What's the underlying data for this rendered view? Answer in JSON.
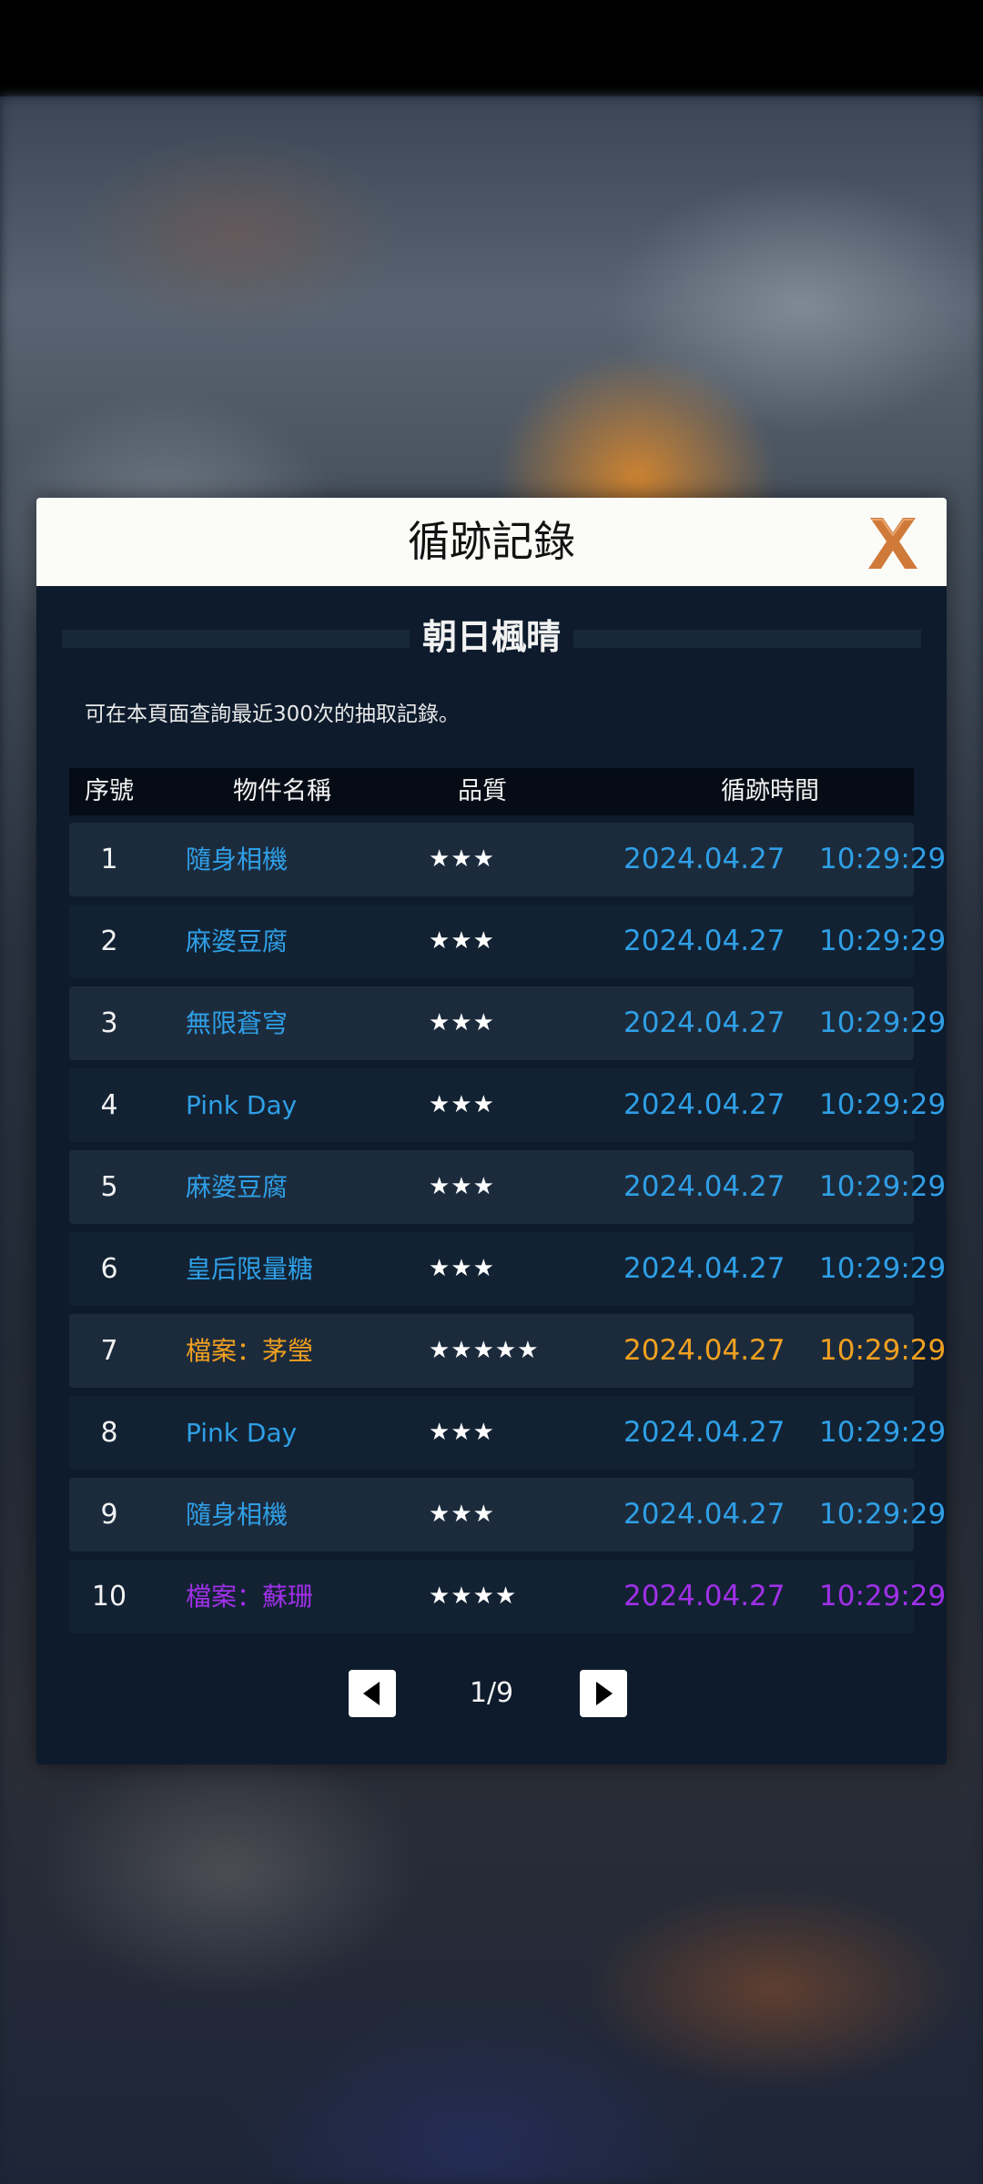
{
  "dialog": {
    "title": "循跡記錄",
    "section_title": "朝日楓晴",
    "description": "可在本頁面查詢最近300次的抽取記錄。"
  },
  "table": {
    "headers": [
      "序號",
      "物件名稱",
      "品質",
      "循跡時間"
    ],
    "rows": [
      {
        "index": "1",
        "name": "隨身相機",
        "stars": "★★★",
        "date": "2024.04.27",
        "time": "10:29:29",
        "rarity": "blue"
      },
      {
        "index": "2",
        "name": "麻婆豆腐",
        "stars": "★★★",
        "date": "2024.04.27",
        "time": "10:29:29",
        "rarity": "blue"
      },
      {
        "index": "3",
        "name": "無限蒼穹",
        "stars": "★★★",
        "date": "2024.04.27",
        "time": "10:29:29",
        "rarity": "blue"
      },
      {
        "index": "4",
        "name": "Pink Day",
        "stars": "★★★",
        "date": "2024.04.27",
        "time": "10:29:29",
        "rarity": "blue"
      },
      {
        "index": "5",
        "name": "麻婆豆腐",
        "stars": "★★★",
        "date": "2024.04.27",
        "time": "10:29:29",
        "rarity": "blue"
      },
      {
        "index": "6",
        "name": "皇后限量糖",
        "stars": "★★★",
        "date": "2024.04.27",
        "time": "10:29:29",
        "rarity": "blue"
      },
      {
        "index": "7",
        "name": "檔案：茅瑩",
        "stars": "★★★★★",
        "date": "2024.04.27",
        "time": "10:29:29",
        "rarity": "orange"
      },
      {
        "index": "8",
        "name": "Pink Day",
        "stars": "★★★",
        "date": "2024.04.27",
        "time": "10:29:29",
        "rarity": "blue"
      },
      {
        "index": "9",
        "name": "隨身相機",
        "stars": "★★★",
        "date": "2024.04.27",
        "time": "10:29:29",
        "rarity": "blue"
      },
      {
        "index": "10",
        "name": "檔案：蘇珊",
        "stars": "★★★★",
        "date": "2024.04.27",
        "time": "10:29:29",
        "rarity": "purple"
      }
    ]
  },
  "pagination": {
    "label": "1/9",
    "prev_icon": "triangle-left-icon",
    "next_icon": "triangle-right-icon"
  },
  "icons": {
    "close": "close-x-icon"
  },
  "colors": {
    "rarity_blue": "#2f9fe6",
    "rarity_orange": "#f0a020",
    "rarity_purple": "#a030e8",
    "close_icon": "#d07a3a",
    "dialog_bg": "#0d1b2c",
    "header_bg": "#fbfbf8"
  }
}
